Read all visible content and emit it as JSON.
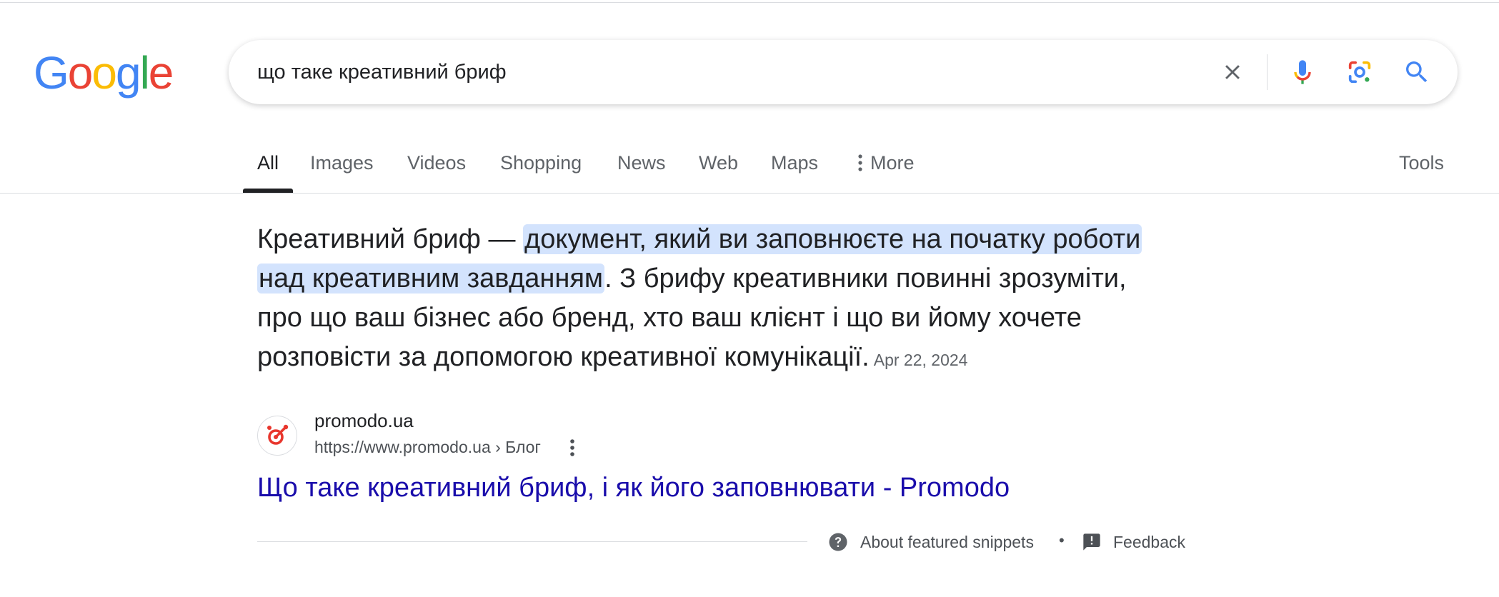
{
  "logo": {
    "letters": [
      "G",
      "o",
      "o",
      "g",
      "l",
      "e"
    ],
    "colors": [
      "#4285F4",
      "#EA4335",
      "#FBBC05",
      "#4285F4",
      "#34A853",
      "#EA4335"
    ]
  },
  "search": {
    "query": "що таке креативний бриф",
    "icons": [
      "clear-icon",
      "microphone-icon",
      "lens-icon",
      "search-icon"
    ]
  },
  "tabs": {
    "items": [
      {
        "label": "All",
        "active": true
      },
      {
        "label": "Images",
        "active": false
      },
      {
        "label": "Videos",
        "active": false
      },
      {
        "label": "Shopping",
        "active": false
      },
      {
        "label": "News",
        "active": false
      },
      {
        "label": "Web",
        "active": false
      },
      {
        "label": "Maps",
        "active": false
      },
      {
        "label": "More",
        "active": false,
        "icon": "kebab-icon"
      }
    ],
    "tools_label": "Tools"
  },
  "snippet": {
    "lead": "Креативний бриф — ",
    "highlight_1": "документ, який ви заповнюєте на початку роботи",
    "highlight_2": "над креативним завданням",
    "rest_1": ". З брифу креативники повинні зрозуміти,",
    "rest_2": "про що ваш бізнес або бренд, хто ваш клієнт і що ви йому хочете",
    "rest_3": "розповісти за допомогою креативної комунікації.",
    "date": "Apr 22, 2024",
    "highlight_color": "#d3e3fd"
  },
  "source": {
    "site_name": "promodo.ua",
    "url": "https://www.promodo.ua › Блог",
    "favicon": "promodo-logo-icon",
    "title": "Що таке креативний бриф, і як його заповнювати - Promodo",
    "link_color": "#1a0dab"
  },
  "footer": {
    "about_label": "About featured snippets",
    "separator": "•",
    "feedback_label": "Feedback"
  }
}
